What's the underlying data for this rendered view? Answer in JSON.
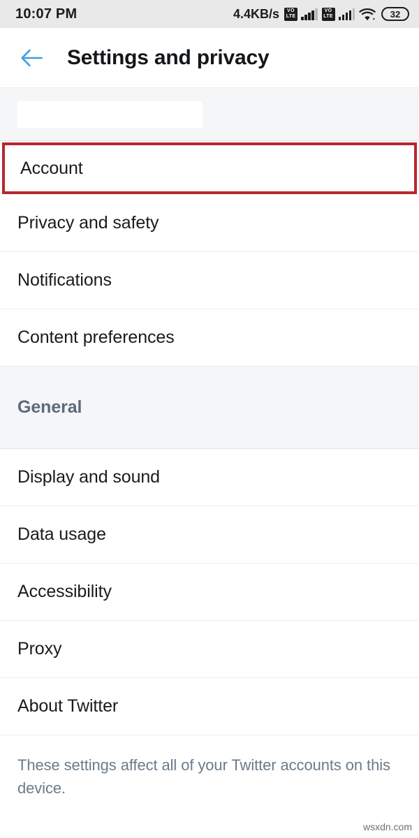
{
  "status_bar": {
    "clock": "10:07 PM",
    "network_speed": "4.4KB/s",
    "volte_top": "VO",
    "volte_bottom": "LTE",
    "battery_level": "32",
    "icons": [
      "volte-icon",
      "signal-bars-icon",
      "volte-icon",
      "signal-bars-icon",
      "wifi-icon",
      "battery-icon"
    ]
  },
  "appbar": {
    "back_icon": "arrow-left-icon",
    "title": "Settings and privacy",
    "accent_color": "#3c9ede"
  },
  "account_section": {
    "redacted_label": "",
    "items": [
      {
        "label": "Account",
        "highlighted": true
      },
      {
        "label": "Privacy and safety",
        "highlighted": false
      },
      {
        "label": "Notifications",
        "highlighted": false
      },
      {
        "label": "Content preferences",
        "highlighted": false
      }
    ]
  },
  "general_section": {
    "title": "General",
    "items": [
      {
        "label": "Display and sound"
      },
      {
        "label": "Data usage"
      },
      {
        "label": "Accessibility"
      },
      {
        "label": "Proxy"
      },
      {
        "label": "About Twitter"
      }
    ]
  },
  "footer": {
    "note": "These settings affect all of your Twitter accounts on this device."
  },
  "watermark": {
    "text": "wsxdn.com"
  },
  "colors": {
    "highlight_red": "#b72730",
    "twitter_blue": "#3c9ede",
    "section_header_text": "#5c6b7a",
    "band_background": "#f5f6f8"
  }
}
